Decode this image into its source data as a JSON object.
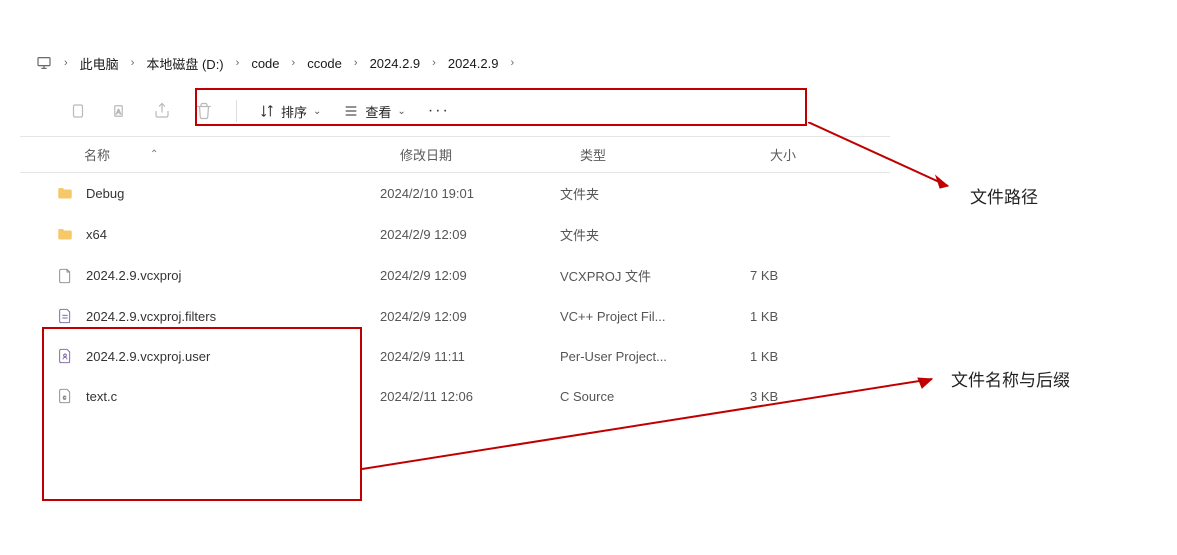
{
  "breadcrumb": {
    "root": "此电脑",
    "items": [
      "本地磁盘 (D:)",
      "code",
      "ccode",
      "2024.2.9",
      "2024.2.9"
    ]
  },
  "toolbar": {
    "sort": "排序",
    "view": "查看"
  },
  "headers": {
    "name": "名称",
    "date": "修改日期",
    "type": "类型",
    "size": "大小"
  },
  "rows": [
    {
      "icon": "folder",
      "name": "Debug",
      "date": "2024/2/10 19:01",
      "type": "文件夹",
      "size": ""
    },
    {
      "icon": "folder",
      "name": "x64",
      "date": "2024/2/9 12:09",
      "type": "文件夹",
      "size": ""
    },
    {
      "icon": "file",
      "name": "2024.2.9.vcxproj",
      "date": "2024/2/9 12:09",
      "type": "VCXPROJ 文件",
      "size": "7 KB"
    },
    {
      "icon": "filters",
      "name": "2024.2.9.vcxproj.filters",
      "date": "2024/2/9 12:09",
      "type": "VC++ Project Fil...",
      "size": "1 KB"
    },
    {
      "icon": "user",
      "name": "2024.2.9.vcxproj.user",
      "date": "2024/2/9 11:11",
      "type": "Per-User Project...",
      "size": "1 KB"
    },
    {
      "icon": "csrc",
      "name": "text.c",
      "date": "2024/2/11 12:06",
      "type": "C Source",
      "size": "3 KB"
    }
  ],
  "annotations": {
    "path": "文件路径",
    "name_ext": "文件名称与后缀"
  }
}
